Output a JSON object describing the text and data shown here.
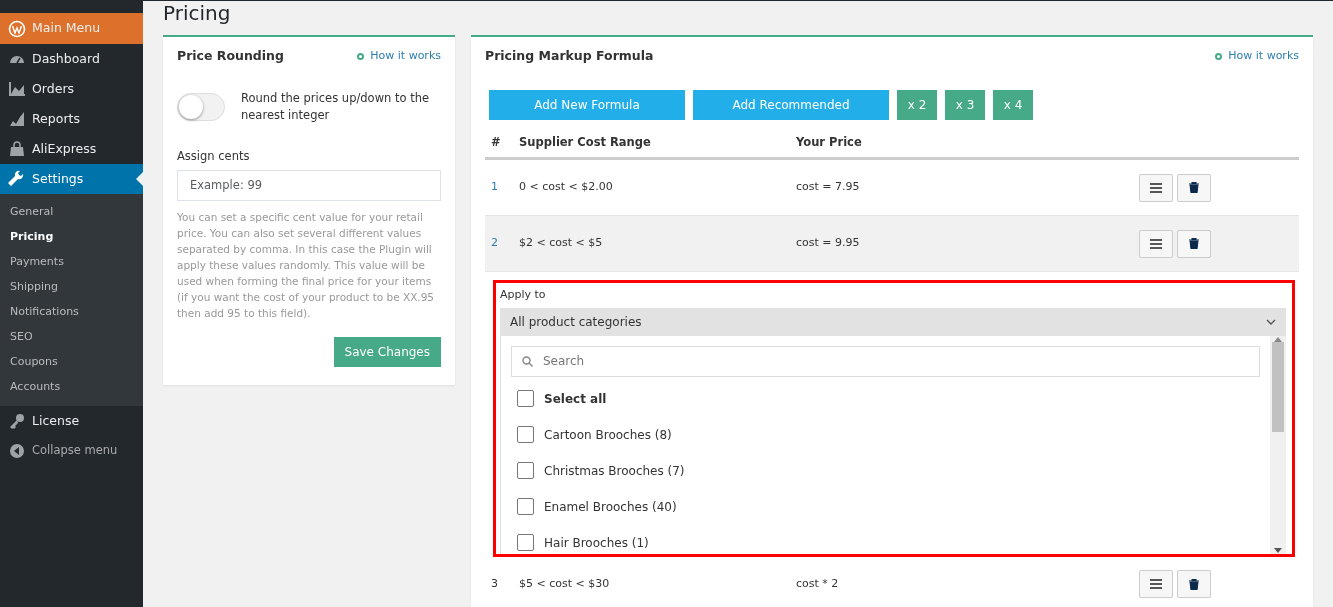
{
  "sidebar": {
    "items": [
      {
        "label": "Main Menu",
        "kind": "brand",
        "selected": false
      },
      {
        "label": "Dashboard",
        "kind": "item",
        "selected": false
      },
      {
        "label": "Orders",
        "kind": "item",
        "selected": false
      },
      {
        "label": "Reports",
        "kind": "item",
        "selected": false
      },
      {
        "label": "AliExpress",
        "kind": "item",
        "selected": false
      },
      {
        "label": "Settings",
        "kind": "item",
        "selected": true,
        "children": [
          {
            "label": "General",
            "selected": false
          },
          {
            "label": "Pricing",
            "selected": true
          },
          {
            "label": "Payments",
            "selected": false
          },
          {
            "label": "Shipping",
            "selected": false
          },
          {
            "label": "Notifications",
            "selected": false
          },
          {
            "label": "SEO",
            "selected": false
          },
          {
            "label": "Coupons",
            "selected": false
          },
          {
            "label": "Accounts",
            "selected": false
          }
        ]
      },
      {
        "label": "License",
        "kind": "item",
        "selected": false
      },
      {
        "label": "Collapse menu",
        "kind": "collapse",
        "selected": false
      }
    ]
  },
  "page_title": "Pricing",
  "rounding": {
    "title": "Price Rounding",
    "help_link": "How it works",
    "toggle": {
      "label": "Round the prices up/down to the nearest integer",
      "on": false
    },
    "cents_label": "Assign cents",
    "cents_placeholder": "Example: 99",
    "hint": "You can set a specific cent value for your retail price. You can also set several different values separated by comma. In this case the Plugin will apply these values randomly. This value will be used when forming the final price for your items (if you want the cost of your product to be XX.95 then add 95 to this field).",
    "save_button": "Save Changes"
  },
  "markup": {
    "title": "Pricing Markup Formula",
    "help_link": "How it works",
    "buttons": [
      {
        "label": "Add New Formula",
        "kind": "wide"
      },
      {
        "label": "Add Recommended",
        "kind": "wide"
      },
      {
        "label": "x 2",
        "kind": "small"
      },
      {
        "label": "x 3",
        "kind": "small"
      },
      {
        "label": "x 4",
        "kind": "small"
      }
    ],
    "columns": [
      "#",
      "Supplier Cost Range",
      "Your Price"
    ],
    "rows": [
      {
        "index": "1",
        "range": "0 < cost < $2.00",
        "price": "cost = 7.95"
      },
      {
        "index": "2",
        "range": "$2 < cost < $5",
        "price": "cost = 9.95"
      },
      {
        "index": "3",
        "range": "$5 < cost < $30",
        "price": "cost * 2"
      }
    ],
    "apply_to": {
      "label": "Apply to",
      "value": "All product categories",
      "search_placeholder": "Search",
      "options": [
        {
          "label": "Select all",
          "checked": false,
          "kind": "all"
        },
        {
          "label": "Cartoon Brooches (8)",
          "checked": false,
          "kind": "option"
        },
        {
          "label": "Christmas Brooches (7)",
          "checked": false,
          "kind": "option"
        },
        {
          "label": "Enamel Brooches (40)",
          "checked": false,
          "kind": "option"
        },
        {
          "label": "Hair Brooches (1)",
          "checked": false,
          "kind": "option"
        }
      ]
    }
  }
}
